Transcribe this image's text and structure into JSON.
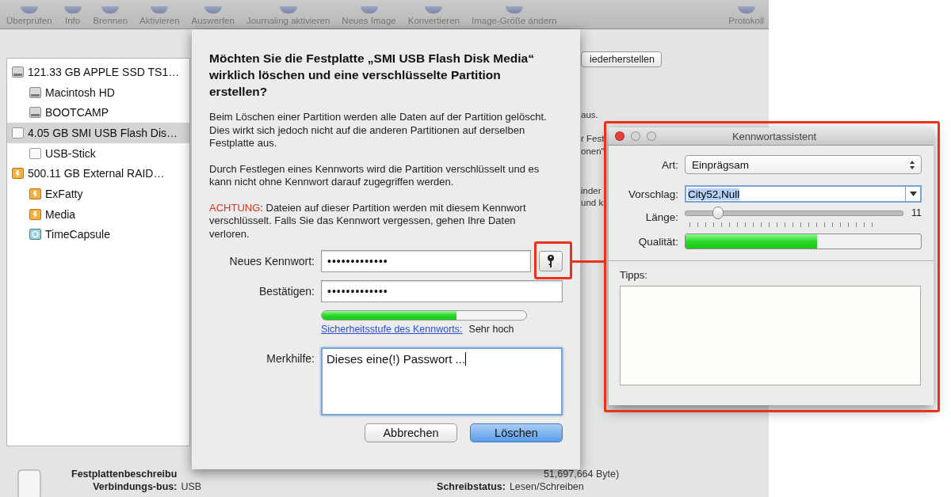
{
  "toolbar": {
    "items": [
      {
        "label": "Überprüfen"
      },
      {
        "label": "Info"
      },
      {
        "label": "Brennen"
      },
      {
        "label": "Aktivieren"
      },
      {
        "label": "Auswerfen"
      },
      {
        "label": "Journaling aktivieren"
      },
      {
        "label": "Neues Image"
      },
      {
        "label": "Konvertieren"
      },
      {
        "label": "Image-Größe ändern"
      },
      {
        "label": "Protokoll"
      }
    ]
  },
  "sidebar": {
    "items": [
      {
        "label": "121.33 GB APPLE SSD TS1…",
        "kind": "internal",
        "selected": false,
        "children": [
          {
            "label": "Macintosh HD",
            "kind": "internal",
            "selected": false
          },
          {
            "label": "BOOTCAMP",
            "kind": "internal",
            "selected": false
          }
        ]
      },
      {
        "label": "4.05 GB SMI USB Flash Dis…",
        "kind": "usb",
        "selected": true,
        "children": [
          {
            "label": "USB-Stick",
            "kind": "usb",
            "selected": false
          }
        ]
      },
      {
        "label": "500.11 GB External RAID…",
        "kind": "external",
        "selected": false,
        "children": [
          {
            "label": "ExFatty",
            "kind": "external",
            "selected": false
          },
          {
            "label": "Media",
            "kind": "external",
            "selected": false
          },
          {
            "label": "TimeCapsule",
            "kind": "network",
            "selected": false
          }
        ]
      }
    ]
  },
  "panel": {
    "restore_button": "iederherstellen",
    "text_fragments": [
      "aus.",
      "r Fest",
      "onen“",
      "inder",
      "und k"
    ]
  },
  "info": {
    "left": [
      {
        "label": "Festplattenbeschreibu"
      },
      {
        "label": "Verbindungs-bus:",
        "value": "USB"
      }
    ],
    "right": [
      {
        "value": "51,697,664 Byte)"
      },
      {
        "label": "Schreibstatus:",
        "value": "Lesen/Schreiben"
      }
    ]
  },
  "sheet": {
    "title": "Möchten Sie die Festplatte „SMI USB Flash Disk Media“ wirklich löschen und eine verschlüsselte Partition erstellen?",
    "paragraphs": [
      "Beim Löschen einer Partition werden alle Daten auf der Partition gelöscht. Dies wirkt sich jedoch nicht auf die anderen Partitionen auf derselben Festplatte aus.",
      "Durch Festlegen eines Kennworts wird die Partition verschlüsselt und es kann nicht ohne Kennwort darauf zugegriffen werden."
    ],
    "warning": {
      "prefix": "ACHTUNG",
      "text": ": Dateien auf dieser Partition werden mit diesem Kennwort verschlüsselt. Falls Sie das Kennwort vergessen, gehen Ihre Daten verloren."
    },
    "fields": [
      {
        "label": "Neues Kennwort:",
        "value": "•••••••••••••",
        "kind": "password-with-key"
      },
      {
        "label": "Bestätigen:",
        "value": "•••••••••••••",
        "kind": "password"
      }
    ],
    "strength": {
      "level": 0.66,
      "link": "Sicherheitsstufe des Kennworts:",
      "reading": "Sehr hoch"
    },
    "hint": {
      "label": "Merkhilfe:",
      "value": "Dieses eine(!) Passwort ...",
      "focused": true
    },
    "buttons": [
      {
        "label": "Abbrechen",
        "default": false
      },
      {
        "label": "Löschen",
        "default": true
      }
    ]
  },
  "assistant": {
    "title": "Kennwortassistent",
    "type": {
      "label": "Art:",
      "value": "Einprägsam"
    },
    "suggestion": {
      "label": "Vorschlag:",
      "value": "City52,Null"
    },
    "length": {
      "label": "Länge:",
      "level": 0.15,
      "reading": "11"
    },
    "quality": {
      "label": "Qualität:",
      "level": 0.56
    },
    "tips": {
      "label": "Tipps:"
    }
  }
}
